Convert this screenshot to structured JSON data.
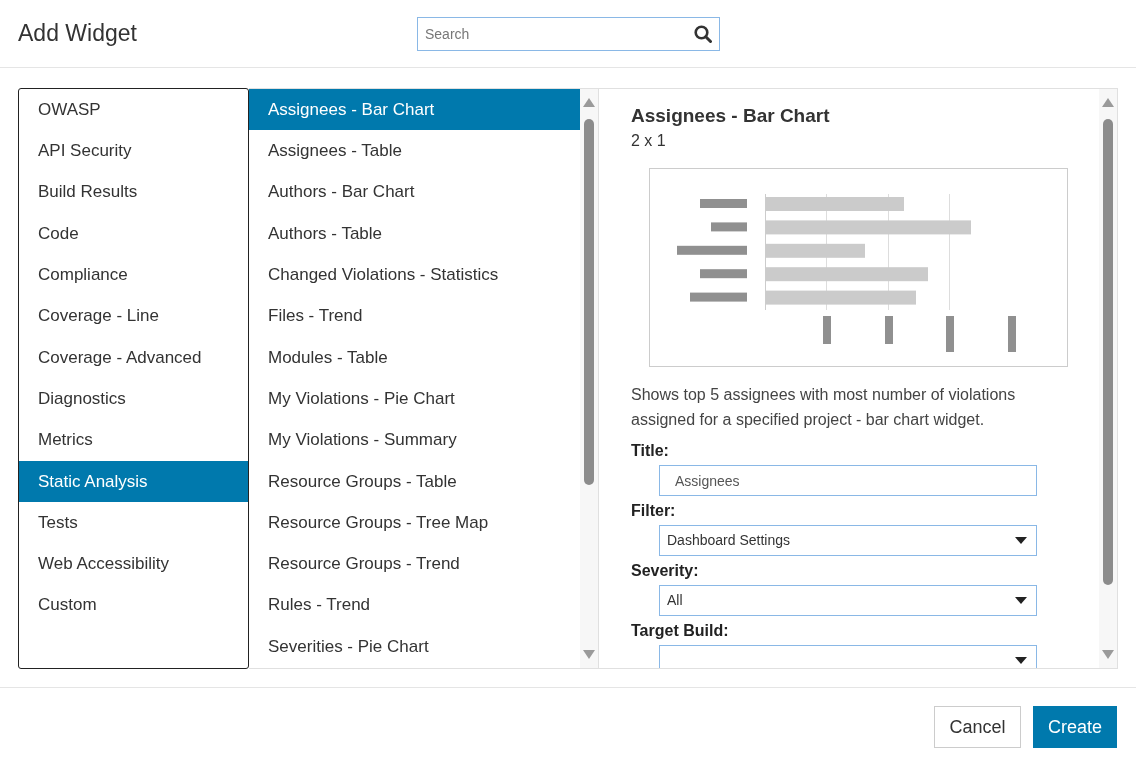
{
  "dialog": {
    "title": "Add Widget"
  },
  "search": {
    "placeholder": "Search"
  },
  "categories": [
    {
      "label": "OWASP",
      "selected": false
    },
    {
      "label": "API Security",
      "selected": false
    },
    {
      "label": "Build Results",
      "selected": false
    },
    {
      "label": "Code",
      "selected": false
    },
    {
      "label": "Compliance",
      "selected": false
    },
    {
      "label": "Coverage - Line",
      "selected": false
    },
    {
      "label": "Coverage - Advanced",
      "selected": false
    },
    {
      "label": "Diagnostics",
      "selected": false
    },
    {
      "label": "Metrics",
      "selected": false
    },
    {
      "label": "Static Analysis",
      "selected": true
    },
    {
      "label": "Tests",
      "selected": false
    },
    {
      "label": "Web Accessibility",
      "selected": false
    },
    {
      "label": "Custom",
      "selected": false
    }
  ],
  "widgets": [
    {
      "label": "Assignees - Bar Chart",
      "selected": true
    },
    {
      "label": "Assignees - Table",
      "selected": false
    },
    {
      "label": "Authors - Bar Chart",
      "selected": false
    },
    {
      "label": "Authors - Table",
      "selected": false
    },
    {
      "label": "Changed Violations - Statistics",
      "selected": false
    },
    {
      "label": "Files - Trend",
      "selected": false
    },
    {
      "label": "Modules - Table",
      "selected": false
    },
    {
      "label": "My Violations - Pie Chart",
      "selected": false
    },
    {
      "label": "My Violations - Summary",
      "selected": false
    },
    {
      "label": "Resource Groups - Table",
      "selected": false
    },
    {
      "label": "Resource Groups - Tree Map",
      "selected": false
    },
    {
      "label": "Resource Groups - Trend",
      "selected": false
    },
    {
      "label": "Rules - Trend",
      "selected": false
    },
    {
      "label": "Severities - Pie Chart",
      "selected": false
    }
  ],
  "details": {
    "title": "Assignees - Bar Chart",
    "size": "2 x 1",
    "description": "Shows top 5 assignees with most number of violations assigned for a specified project - bar chart widget.",
    "fields": [
      {
        "label": "Title:",
        "kind": "text",
        "value": "Assignees"
      },
      {
        "label": "Filter:",
        "kind": "select",
        "value": "Dashboard Settings"
      },
      {
        "label": "Severity:",
        "kind": "select",
        "value": "All"
      },
      {
        "label": "Target Build:",
        "kind": "select"
      }
    ]
  },
  "buttons": [
    {
      "label": "Cancel",
      "kind": "secondary"
    },
    {
      "label": "Create",
      "kind": "primary"
    }
  ]
}
